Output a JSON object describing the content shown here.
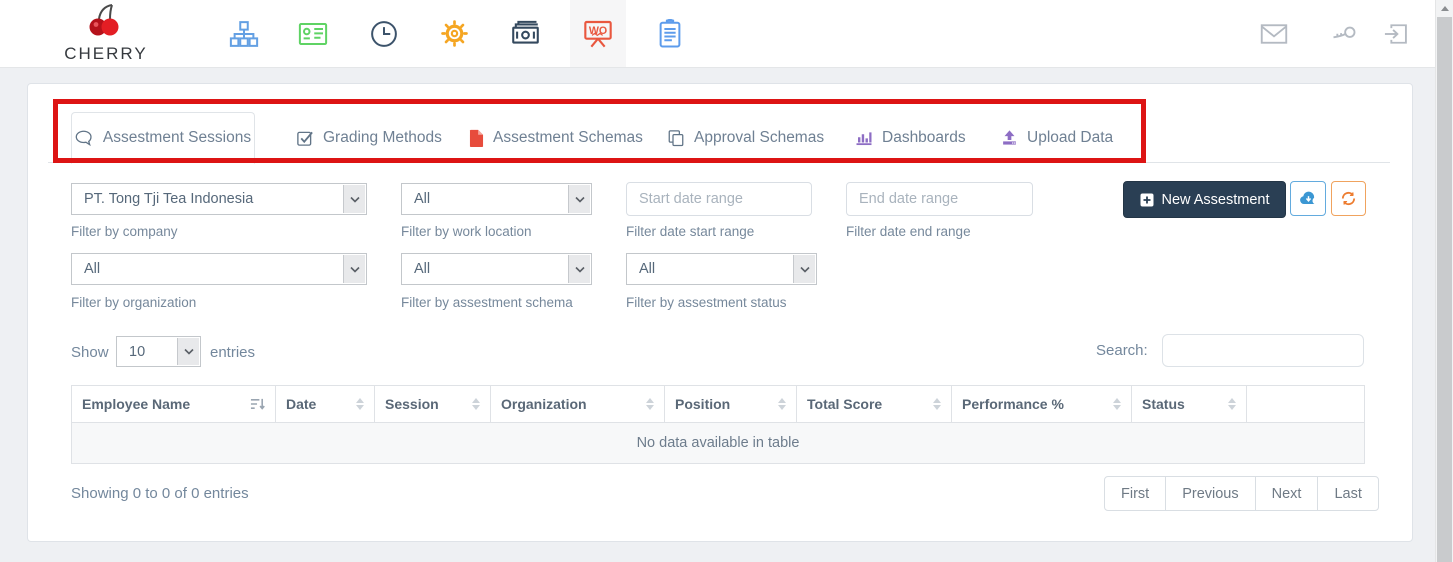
{
  "brand": {
    "name": "CHERRY"
  },
  "navbar": {
    "whiteboard_label": "WO",
    "menu_icons": [
      "sitemap-icon",
      "id-card-icon",
      "clock-icon",
      "gear-icon",
      "money-icon",
      "whiteboard-assessment-icon",
      "clipboard-icon"
    ],
    "active_menu_icon": "whiteboard-assessment-icon",
    "right_icons": [
      "mail-icon",
      "key-icon",
      "logout-icon"
    ]
  },
  "tabs": [
    {
      "label": "Assestment Sessions",
      "icon": "comments-icon",
      "active": true
    },
    {
      "label": "Grading Methods",
      "icon": "check-square-icon",
      "active": false
    },
    {
      "label": "Assestment Schemas",
      "icon": "file-red-icon",
      "active": false
    },
    {
      "label": "Approval Schemas",
      "icon": "copy-icon",
      "active": false
    },
    {
      "label": "Dashboards",
      "icon": "bar-chart-icon",
      "active": false
    },
    {
      "label": "Upload Data",
      "icon": "upload-icon",
      "active": false
    }
  ],
  "filters": {
    "company": {
      "value": "PT. Tong Tji Tea Indonesia",
      "label": "Filter by company"
    },
    "work_location": {
      "value": "All",
      "label": "Filter by work location"
    },
    "date_start": {
      "placeholder": "Start date range",
      "label": "Filter date start range",
      "value": ""
    },
    "date_end": {
      "placeholder": "End date range",
      "label": "Filter date end range",
      "value": ""
    },
    "organization": {
      "value": "All",
      "label": "Filter by organization"
    },
    "assestment_schema": {
      "value": "All",
      "label": "Filter by assestment schema"
    },
    "assestment_status": {
      "value": "All",
      "label": "Filter by assestment status"
    }
  },
  "actions": {
    "new_assestment_label": "New Assestment"
  },
  "table_controls": {
    "show_label": "Show",
    "page_size": "10",
    "entries_label": "entries",
    "search_label": "Search:",
    "search_value": ""
  },
  "table": {
    "columns": [
      "Employee Name",
      "Date",
      "Session",
      "Organization",
      "Position",
      "Total Score",
      "Performance %",
      "Status",
      ""
    ],
    "empty_message": "No data available in table"
  },
  "pagination": {
    "summary": "Showing 0 to 0 of 0 entries",
    "buttons": [
      "First",
      "Previous",
      "Next",
      "Last"
    ]
  },
  "colors": {
    "accent_dark": "#2a3f54",
    "button_blue": "#3b97d3",
    "button_orange": "#ed7d31",
    "annotation_red": "#dd1414",
    "tab_file_red": "#e74c3c",
    "tab_purple": "#8d6dc4",
    "icon_green": "#5fd364",
    "icon_blue": "#64a0e3",
    "icon_orange": "#f5a623"
  }
}
